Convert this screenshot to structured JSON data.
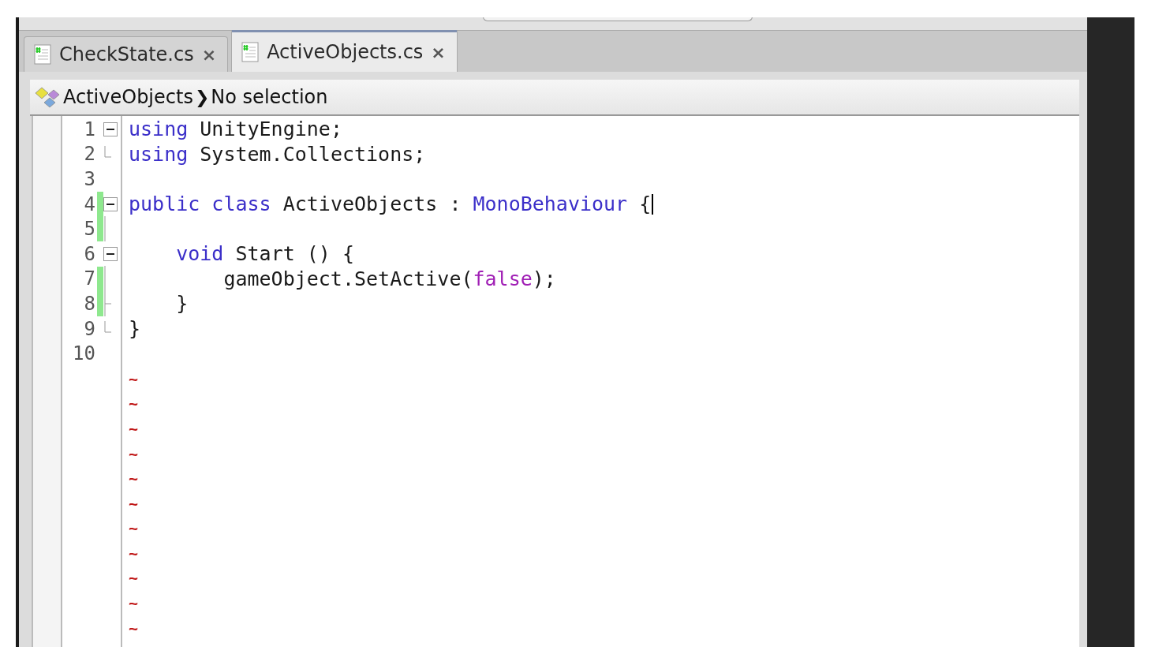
{
  "tabs": [
    {
      "label": "CheckState.cs",
      "close": "×",
      "selected": false
    },
    {
      "label": "ActiveObjects.cs",
      "close": "×",
      "selected": true
    }
  ],
  "breadcrumb": {
    "class_name": "ActiveObjects",
    "separator": "❯",
    "member": "No selection"
  },
  "editor": {
    "lines": [
      {
        "number": "1",
        "kind": "fold-start",
        "changed": false,
        "caret": false,
        "tokens": [
          {
            "text": "using",
            "kind": "keyword"
          },
          {
            "text": " UnityEngine;",
            "kind": "plain"
          }
        ]
      },
      {
        "number": "2",
        "kind": "fold-end",
        "changed": false,
        "caret": false,
        "tokens": [
          {
            "text": "using",
            "kind": "keyword"
          },
          {
            "text": " System.Collections;",
            "kind": "plain"
          }
        ]
      },
      {
        "number": "3",
        "kind": "plain",
        "changed": false,
        "caret": false
      },
      {
        "number": "4",
        "kind": "fold-start",
        "changed": true,
        "caret": true,
        "tokens": [
          {
            "text": "public class",
            "kind": "keyword"
          },
          {
            "text": " ActiveObjects : ",
            "kind": "plain"
          },
          {
            "text": "MonoBehaviour",
            "kind": "type"
          },
          {
            "text": " {",
            "kind": "plain"
          }
        ]
      },
      {
        "number": "5",
        "kind": "fold-line",
        "changed": true,
        "caret": false
      },
      {
        "number": "6",
        "kind": "fold-start",
        "changed": false,
        "caret": false,
        "tokens": [
          {
            "text": "    void",
            "kind": "keyword"
          },
          {
            "text": " Start () {",
            "kind": "plain"
          }
        ]
      },
      {
        "number": "7",
        "kind": "fold-line",
        "changed": true,
        "caret": false,
        "tokens": [
          {
            "text": "        gameObject.SetActive(",
            "kind": "plain"
          },
          {
            "text": "false",
            "kind": "literal"
          },
          {
            "text": ");",
            "kind": "plain"
          }
        ]
      },
      {
        "number": "8",
        "kind": "fold-branch",
        "changed": true,
        "caret": false,
        "tokens": [
          {
            "text": "    }",
            "kind": "plain"
          }
        ]
      },
      {
        "number": "9",
        "kind": "fold-end",
        "changed": false,
        "caret": false,
        "tokens": [
          {
            "text": "}",
            "kind": "plain"
          }
        ]
      },
      {
        "number": "10",
        "kind": "plain",
        "changed": false,
        "caret": false
      }
    ],
    "empty_line_markers": [
      "~",
      "~",
      "~",
      "~",
      "~",
      "~",
      "~",
      "~",
      "~",
      "~",
      "~"
    ]
  }
}
